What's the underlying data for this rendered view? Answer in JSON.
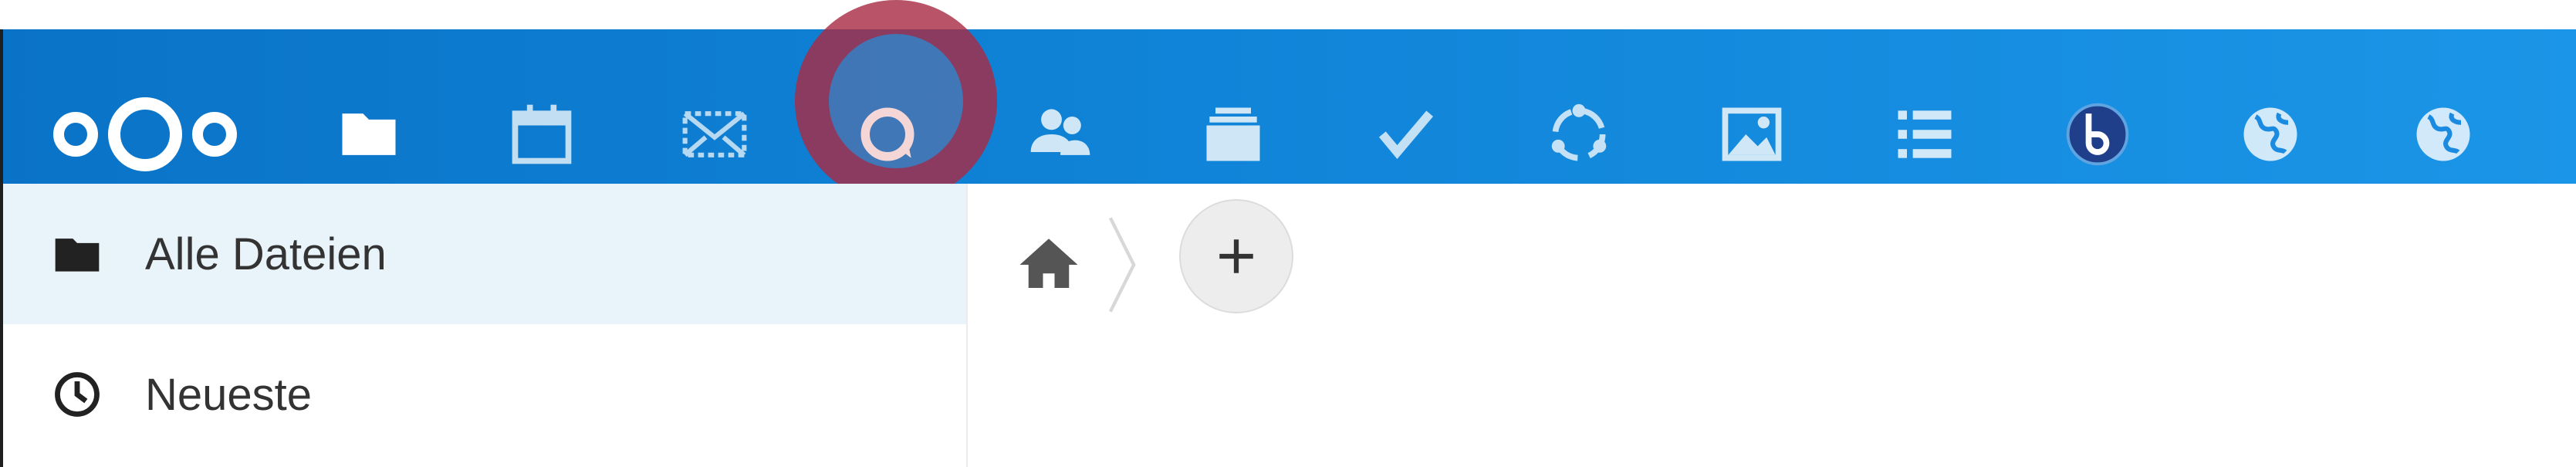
{
  "header": {
    "brand": "Nextcloud",
    "apps": [
      {
        "id": "files",
        "icon": "folder-icon"
      },
      {
        "id": "calendar",
        "icon": "calendar-icon"
      },
      {
        "id": "mail",
        "icon": "mail-icon"
      },
      {
        "id": "talk",
        "icon": "talk-icon"
      },
      {
        "id": "contacts",
        "icon": "contacts-icon"
      },
      {
        "id": "deck",
        "icon": "deck-icon"
      },
      {
        "id": "tasks",
        "icon": "checkmark-icon"
      },
      {
        "id": "circles",
        "icon": "circles-icon"
      },
      {
        "id": "photos",
        "icon": "image-icon"
      },
      {
        "id": "activity",
        "icon": "list-icon"
      },
      {
        "id": "bigbluebutton",
        "icon": "bbb-icon"
      },
      {
        "id": "external-site-1",
        "icon": "globe-icon"
      },
      {
        "id": "external-site-2",
        "icon": "globe-icon"
      }
    ],
    "active_app": "files",
    "highlighted_app": "talk"
  },
  "sidebar": {
    "items": [
      {
        "label": "Alle Dateien",
        "icon": "folder-icon",
        "active": true
      },
      {
        "label": "Neueste",
        "icon": "clock-icon",
        "active": false
      }
    ]
  },
  "breadcrumb": {
    "home_icon": "home-icon",
    "add_icon": "plus-icon"
  },
  "colors": {
    "header_start": "#0a73c7",
    "header_end": "#1b95e7",
    "active_bg": "#e8f4fa",
    "highlight": "#a52844"
  }
}
